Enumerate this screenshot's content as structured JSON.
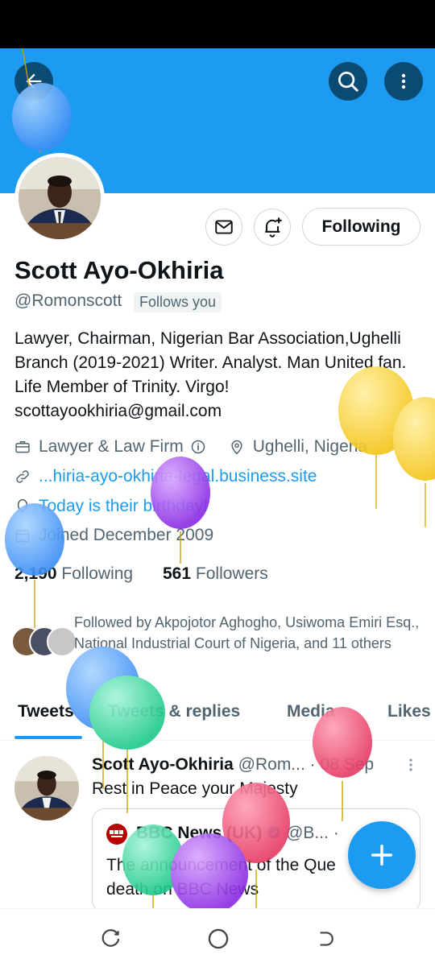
{
  "profile": {
    "name": "Scott Ayo-Okhiria",
    "handle": "@Romonscott",
    "follows_you": "Follows you",
    "bio": "Lawyer, Chairman, Nigerian Bar Association,Ughelli Branch (2019-2021) Writer. Analyst. Man United fan. Life Member of Trinity. Virgo! scottayookhiria@gmail.com",
    "category": "Lawyer & Law Firm",
    "location": "Ughelli, Nigeria",
    "website": "...hiria-ayo-okhiria-legal.business.site",
    "birthday": "Today is their birthday!",
    "joined": "Joined December 2009",
    "following_count": "2,190",
    "following_label": "Following",
    "followers_count": "561",
    "followers_label": "Followers",
    "followed_by": "Followed by Akpojotor Aghogho, Usiwoma Emiri Esq., National Industrial Court of Nigeria, and 11 others"
  },
  "actions": {
    "following_button": "Following"
  },
  "tabs": [
    "Tweets",
    "Tweets & replies",
    "Media",
    "Likes"
  ],
  "tweet": {
    "author": "Scott Ayo-Okhiria",
    "handle": "@Rom...",
    "separator": "·",
    "date": "08 Sep",
    "text": "Rest in Peace your Majesty",
    "quote": {
      "author": "BBC News (UK)",
      "handle": "@B...",
      "separator": "·",
      "text_line1": "The announcement of the Que",
      "text_line2": "death on BBC News"
    }
  },
  "colors": {
    "accent": "#1d9bf0",
    "banner": "#1d9bf0",
    "text_primary": "#0f1419",
    "text_secondary": "#536471"
  },
  "icons": [
    "back-arrow-icon",
    "search-icon",
    "more-vertical-icon",
    "mail-icon",
    "bell-add-icon",
    "briefcase-icon",
    "info-icon",
    "location-pin-icon",
    "link-icon",
    "balloon-icon",
    "calendar-icon",
    "more-dots-icon",
    "verified-icon",
    "compose-plus-icon",
    "recents-icon",
    "home-icon",
    "back-nav-icon"
  ]
}
